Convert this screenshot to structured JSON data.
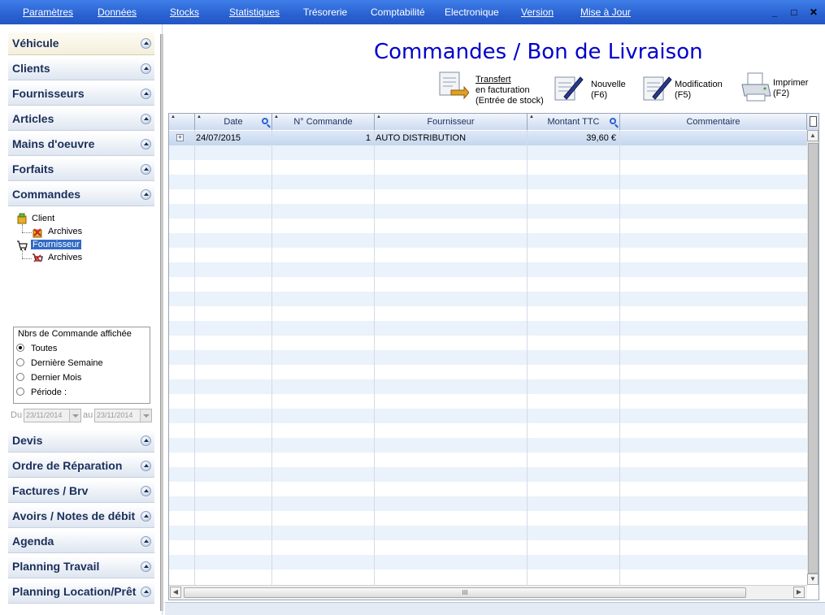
{
  "menu": [
    "Paramètres",
    "Données",
    "Stocks",
    "Statistiques",
    "Trésorerie",
    "Comptabilité",
    "Electronique",
    "Version",
    "Mise à Jour"
  ],
  "window_controls": {
    "minimize": "_",
    "maximize": "□",
    "close": "✕"
  },
  "sidebar": {
    "sections_top": [
      "Véhicule",
      "Clients",
      "Fournisseurs",
      "Articles",
      "Mains d'oeuvre",
      "Forfaits",
      "Commandes"
    ],
    "tree": {
      "client": "Client",
      "client_archives": "Archives",
      "fournisseur": "Fournisseur",
      "fournisseur_archives": "Archives"
    },
    "filter": {
      "legend": "Nbrs de Commande affichée",
      "options": [
        "Toutes",
        "Dernière Semaine",
        "Dernier Mois",
        "Période :"
      ],
      "selected": "Toutes",
      "from_label": "Du",
      "from_value": "23/11/2014",
      "to_label": "au",
      "to_value": "23/11/2014"
    },
    "sections_bottom": [
      "Devis",
      "Ordre de Réparation",
      "Factures / Brv",
      "Avoirs / Notes de débit",
      "Agenda",
      "Planning Travail",
      "Planning Location/Prêt"
    ]
  },
  "main": {
    "title": "Commandes / Bon de Livraison",
    "toolbar": {
      "transfert": [
        "Transfert",
        "en facturation",
        "(Entrée de stock)"
      ],
      "nouvelle": [
        "Nouvelle",
        "(F6)"
      ],
      "modification": [
        "Modification",
        "(F5)"
      ],
      "imprimer": [
        "Imprimer",
        "(F2)"
      ]
    }
  },
  "grid": {
    "columns": [
      "Date",
      "N° Commande",
      "Fournisseur",
      "Montant TTC",
      "Commentaire"
    ],
    "rows": [
      {
        "date": "24/07/2015",
        "numero": "1",
        "fournisseur": "AUTO DISTRIBUTION",
        "montant": "39,60 €",
        "commentaire": ""
      }
    ],
    "hscroll_grip": "III"
  }
}
